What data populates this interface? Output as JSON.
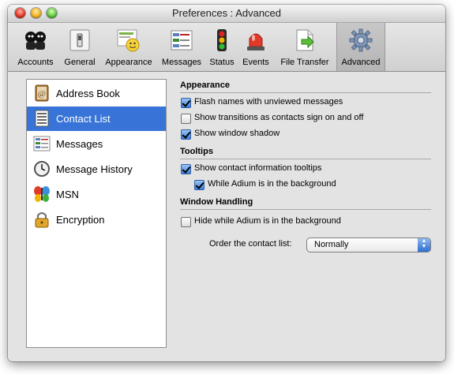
{
  "window": {
    "title": "Preferences : Advanced"
  },
  "toolbar": {
    "items": [
      {
        "label": "Accounts",
        "icon": "accounts-icon"
      },
      {
        "label": "General",
        "icon": "switch-icon"
      },
      {
        "label": "Appearance",
        "icon": "appearance-icon"
      },
      {
        "label": "Messages",
        "icon": "messages-icon"
      },
      {
        "label": "Status",
        "icon": "traffic-light-icon"
      },
      {
        "label": "Events",
        "icon": "siren-icon"
      },
      {
        "label": "File Transfer",
        "icon": "file-transfer-icon"
      },
      {
        "label": "Advanced",
        "icon": "gear-icon",
        "selected": true
      }
    ]
  },
  "sidebar": {
    "items": [
      {
        "label": "Address Book",
        "icon": "address-book-icon"
      },
      {
        "label": "Contact List",
        "icon": "contact-list-icon",
        "selected": true
      },
      {
        "label": "Messages",
        "icon": "messages-icon"
      },
      {
        "label": "Message History",
        "icon": "clock-icon"
      },
      {
        "label": "MSN",
        "icon": "msn-butterfly-icon"
      },
      {
        "label": "Encryption",
        "icon": "lock-icon"
      }
    ]
  },
  "appearance": {
    "heading": "Appearance",
    "flash_names": {
      "label": "Flash names with unviewed messages",
      "checked": true
    },
    "show_transitions": {
      "label": "Show transitions as contacts sign on and off",
      "checked": false
    },
    "show_shadow": {
      "label": "Show window shadow",
      "checked": true
    }
  },
  "tooltips": {
    "heading": "Tooltips",
    "show_tooltips": {
      "label": "Show contact information tooltips",
      "checked": true
    },
    "while_background": {
      "label": "While Adium is in the background",
      "checked": true
    }
  },
  "window_handling": {
    "heading": "Window Handling",
    "hide_background": {
      "label": "Hide while Adium is in the background",
      "checked": false
    },
    "order_label": "Order the contact list:",
    "order_value": "Normally"
  }
}
